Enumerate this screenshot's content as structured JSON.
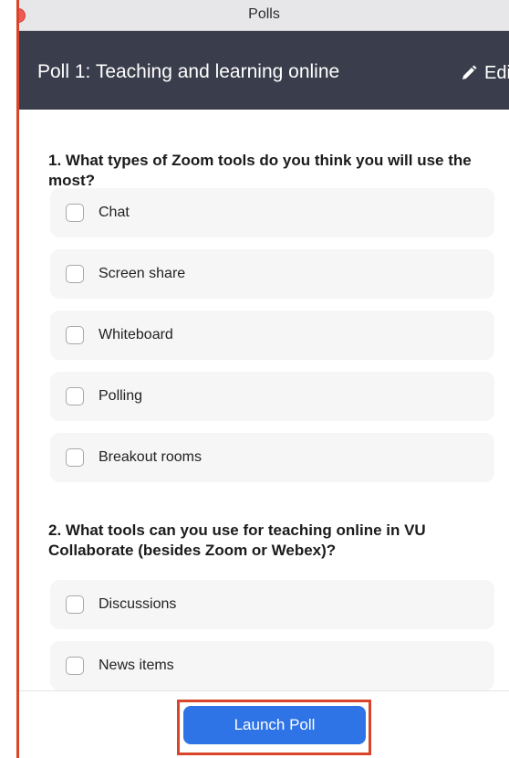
{
  "window": {
    "title": "Polls"
  },
  "header": {
    "poll_title": "Poll 1: Teaching and learning online",
    "edit_label": "Edi",
    "background": "#3a3d4b"
  },
  "questions": [
    {
      "text": "1. What types of Zoom tools do you think you will use the most?",
      "options": [
        "Chat",
        "Screen share",
        "Whiteboard",
        "Polling",
        "Breakout rooms"
      ]
    },
    {
      "text": "2. What tools can you use for teaching online in VU Collaborate (besides Zoom or Webex)?",
      "options": [
        "Discussions",
        "News items"
      ]
    }
  ],
  "footer": {
    "launch_label": "Launch Poll",
    "launch_color": "#2e74e6",
    "highlight_color": "#d9452b"
  },
  "icons": {
    "close": "close-icon",
    "edit": "pencil-icon"
  }
}
